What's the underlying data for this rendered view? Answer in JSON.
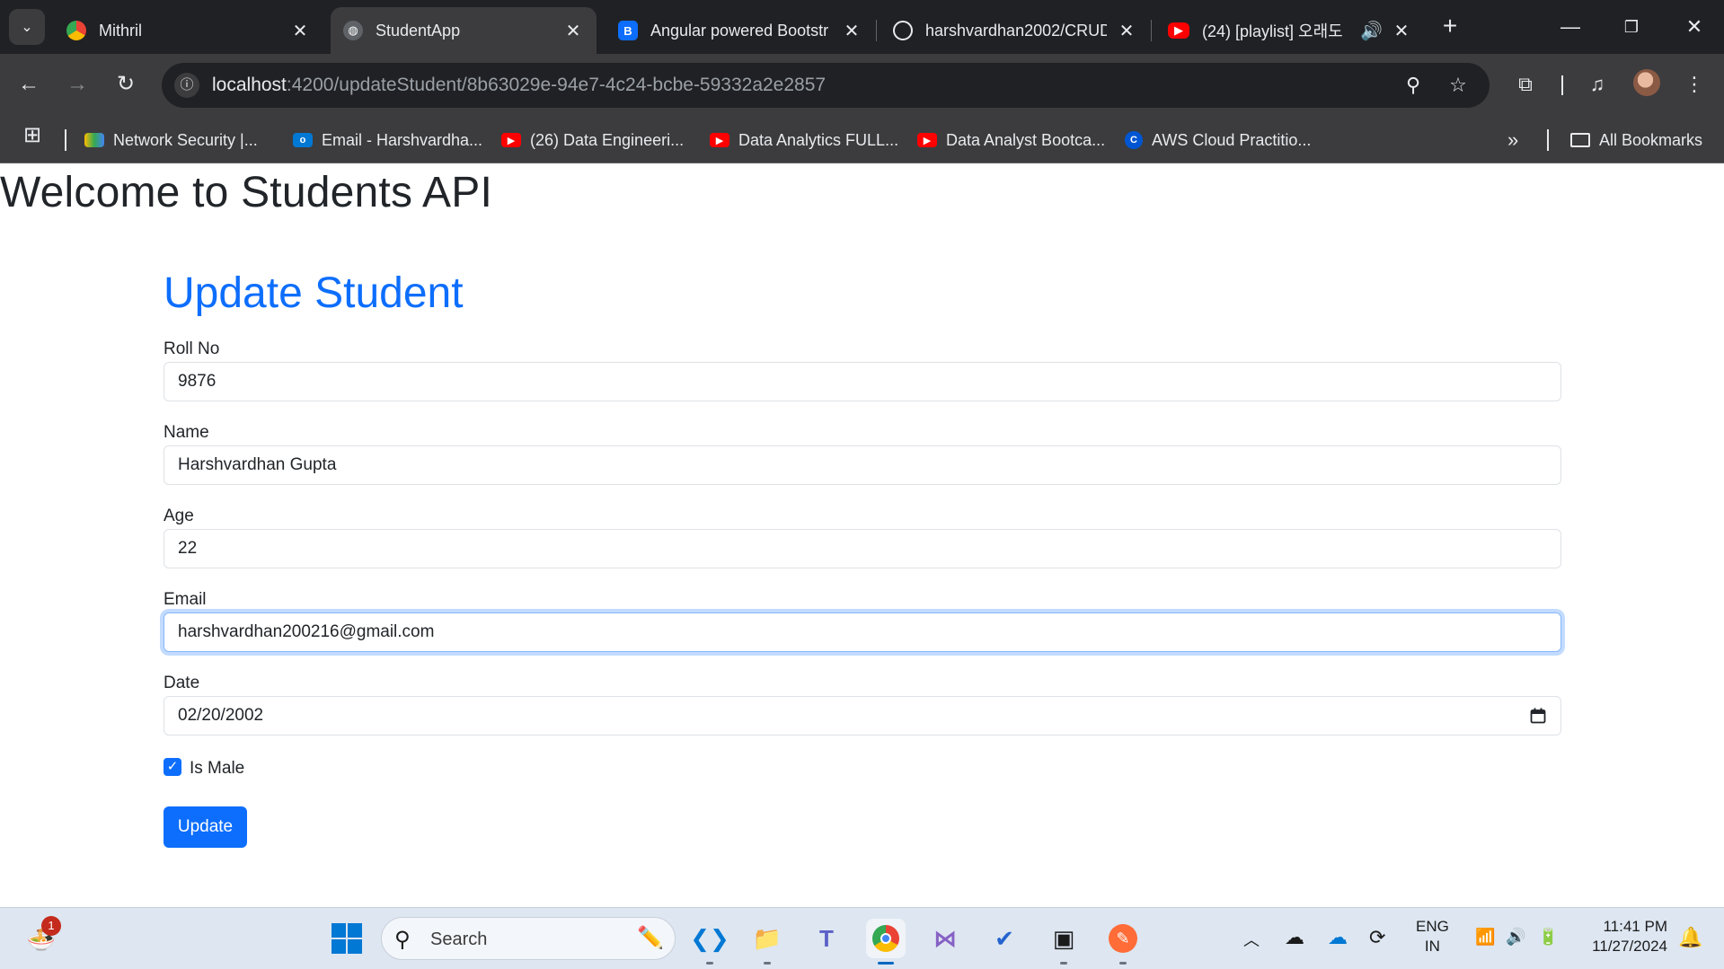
{
  "browser": {
    "tabs": [
      {
        "title": "Mithril",
        "icon": "mithril-icon",
        "active": false
      },
      {
        "title": "StudentApp",
        "icon": "globe-icon",
        "active": true
      },
      {
        "title": "Angular powered Bootstr",
        "icon": "bootstrap-icon",
        "active": false
      },
      {
        "title": "harshvardhan2002/CRUD",
        "icon": "github-icon",
        "active": false
      },
      {
        "title": "(24) [playlist] 오래도",
        "icon": "youtube-icon",
        "active": false,
        "audio": true
      }
    ],
    "url_host": "localhost",
    "url_path": ":4200/updateStudent/8b63029e-94e7-4c24-bcbe-59332a2e2857",
    "bookmarks": [
      {
        "label": "Network Security |...",
        "icon": "drive-icon"
      },
      {
        "label": "Email - Harshvardha...",
        "icon": "outlook-icon"
      },
      {
        "label": "(26) Data Engineeri...",
        "icon": "youtube-icon"
      },
      {
        "label": "Data Analytics FULL...",
        "icon": "youtube-icon"
      },
      {
        "label": "Data Analyst Bootca...",
        "icon": "youtube-icon"
      },
      {
        "label": "AWS Cloud Practitio...",
        "icon": "coursera-icon"
      }
    ],
    "all_bookmarks_label": "All Bookmarks"
  },
  "page": {
    "heading": "Welcome to Students API",
    "form_title": "Update Student",
    "fields": {
      "roll_no": {
        "label": "Roll No",
        "value": "9876"
      },
      "name": {
        "label": "Name",
        "value": "Harshvardhan Gupta"
      },
      "age": {
        "label": "Age",
        "value": "22"
      },
      "email": {
        "label": "Email",
        "value": "harshvardhan200216@gmail.com"
      },
      "date": {
        "label": "Date",
        "value": "02/20/2002"
      }
    },
    "is_male": {
      "label": "Is Male",
      "checked": true
    },
    "update_button": "Update"
  },
  "taskbar": {
    "search_placeholder": "Search",
    "notification_count": "1",
    "language": "ENG",
    "region": "IN",
    "time": "11:41 PM",
    "date": "11/27/2024"
  },
  "colors": {
    "primary": "#0d6efd",
    "chrome_dark": "#202124",
    "chrome_toolbar": "#3c3c3f"
  }
}
